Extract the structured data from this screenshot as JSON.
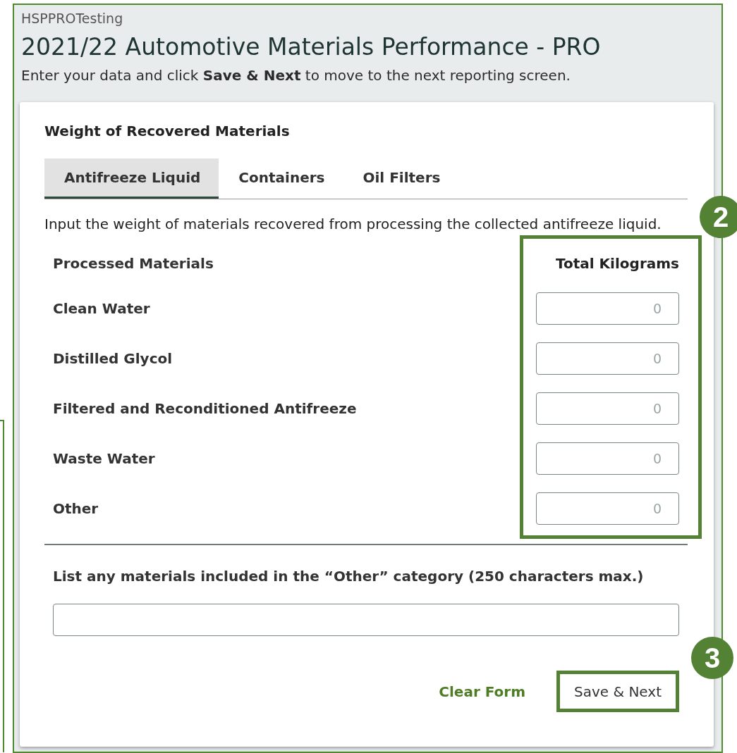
{
  "header": {
    "account": "HSPPROTesting",
    "title": "2021/22 Automotive Materials Performance - PRO",
    "instructions": "Enter your data and click **Save & Next** to move to the next reporting screen."
  },
  "form": {
    "section_title": "Weight of Recovered Materials",
    "tabs": [
      {
        "label": "Antifreeze Liquid",
        "selected": true
      },
      {
        "label": "Containers",
        "selected": false
      },
      {
        "label": "Oil Filters",
        "selected": false
      }
    ],
    "description": "Input the weight of materials recovered from processing the collected antifreeze liquid.",
    "columns": [
      {
        "label": "Processed Materials"
      },
      {
        "label": "Total Kilograms",
        "callout": "2"
      }
    ],
    "rows": [
      {
        "material": "Clean Water",
        "placeholder": "0"
      },
      {
        "material": "Distilled Glycol",
        "placeholder": "0"
      },
      {
        "material": "Filtered and Reconditioned Antifreeze",
        "placeholder": "0"
      },
      {
        "material": "Waste Water",
        "placeholder": "0"
      },
      {
        "material": "Other",
        "placeholder": "0"
      }
    ],
    "other_label": "List any materials included in the “Other” category (250 characters max.)",
    "buttons": [
      {
        "label": "Clear Form",
        "kind": "link"
      },
      {
        "label": "Save & Next",
        "kind": "outlined",
        "callout": "3"
      }
    ]
  }
}
